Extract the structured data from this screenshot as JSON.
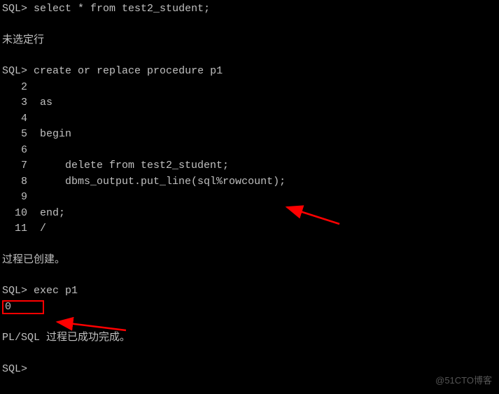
{
  "terminal": {
    "prompt": "SQL>",
    "lines": {
      "cmd1": "select * from test2_student;",
      "msg1": "未选定行",
      "cmd2": "create or replace procedure p1",
      "ln2": "2",
      "code2": "",
      "ln3": "3",
      "code3": "as",
      "ln4": "4",
      "code4": "",
      "ln5": "5",
      "code5": "begin",
      "ln6": "6",
      "code6": "",
      "ln7": "7",
      "code7": "    delete from test2_student;",
      "ln8": "8",
      "code8": "    dbms_output.put_line(sql%rowcount);",
      "ln9": "9",
      "code9": "",
      "ln10": "10",
      "code10": "end;",
      "ln11": "11",
      "code11": "/",
      "msg2": "过程已创建。",
      "cmd3": "exec p1",
      "output": "0",
      "msg3": "PL/SQL 过程已成功完成。"
    }
  },
  "watermark": "@51CTO博客"
}
